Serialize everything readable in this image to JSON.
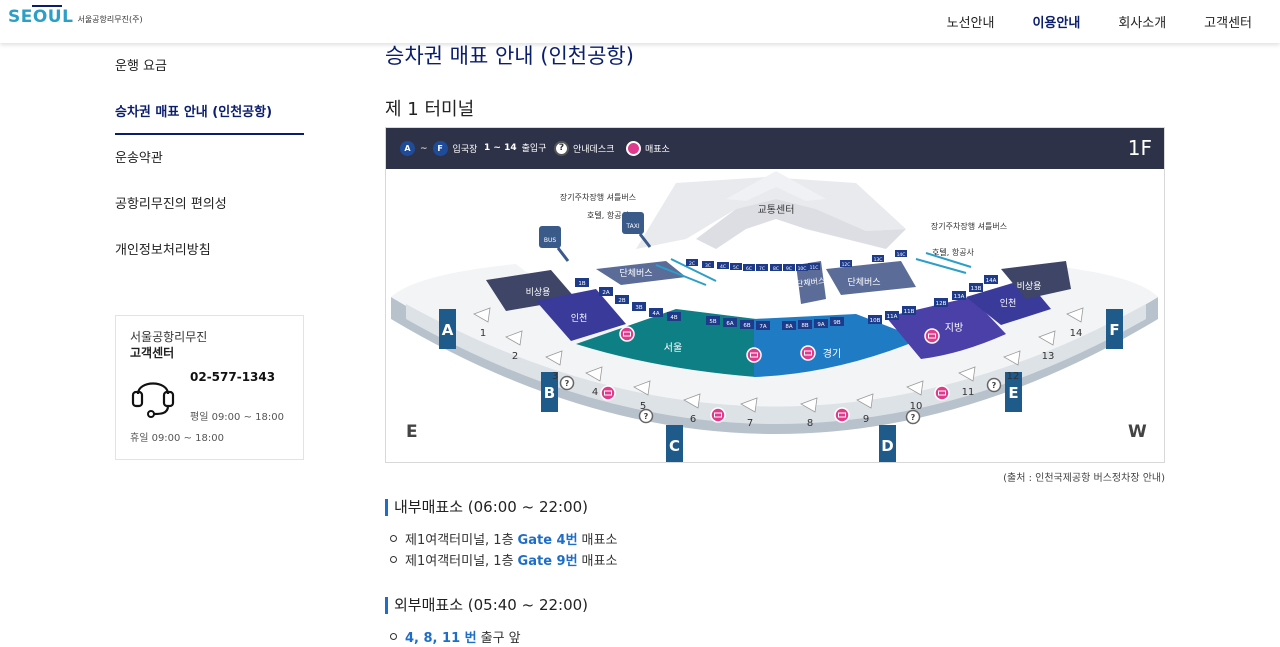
{
  "header": {
    "logo_word": "SEOUL",
    "logo_sub": "서울공항리무진(주)",
    "nav": [
      "노선안내",
      "이용안내",
      "회사소개",
      "고객센터"
    ],
    "active_nav": "이용안내"
  },
  "sidebar": {
    "items": [
      {
        "label": "운행 요금",
        "active": false
      },
      {
        "label": "승차권 매표 안내 (인천공항)",
        "active": true
      },
      {
        "label": "운송약관",
        "active": false
      },
      {
        "label": "공항리무진의 편의성",
        "active": false
      },
      {
        "label": "개인정보처리방침",
        "active": false
      }
    ]
  },
  "contact": {
    "company": "서울공항리무진",
    "title": "고객센터",
    "phone": "02-577-1343",
    "weekday": "평일 09:00 ~ 18:00",
    "holiday": "휴일 09:00 ~ 18:00",
    "icon": "headset-icon"
  },
  "main": {
    "title": "승차권 매표 안내 (인천공항)",
    "subtitle": "제 1 터미널",
    "source": "(출처 : 인천국제공항 버스정차장 안내)"
  },
  "map": {
    "legend": {
      "gate_a": "A",
      "gate_tilde": "~",
      "gate_f": "F",
      "gate_label": "입국장",
      "exits": "1 ~ 14",
      "exits_label": "출입구",
      "info_symbol": "?",
      "info_label": "안내데스크",
      "ticket_label": "매표소"
    },
    "floor": "1F",
    "labels": {
      "traffic_center": "교통센터",
      "long_term_left": "장기주차장행 셔틀버스",
      "hotel_left": "호텔, 항공사",
      "long_term_right": "장기주차장행 셔틀버스",
      "hotel_right": "호텔, 항공사",
      "group_bus_left": "단체버스",
      "group_bus_mid": "단체버스",
      "group_bus_right": "단체버스",
      "emergency_left": "비상용",
      "emergency_right": "비상용",
      "incheon_left": "인천",
      "incheon_right": "인천",
      "seoul": "서울",
      "gyeonggi": "경기",
      "local": "지방",
      "bus": "BUS",
      "taxi": "TAXI",
      "east": "E",
      "west": "W"
    },
    "gates": [
      "A",
      "B",
      "C",
      "D",
      "E",
      "F"
    ],
    "exits": [
      "1",
      "2",
      "3",
      "4",
      "5",
      "6",
      "7",
      "8",
      "9",
      "10",
      "11",
      "12",
      "13",
      "14"
    ],
    "stops_left": [
      "1B",
      "2A",
      "2B",
      "3B",
      "4A",
      "4B",
      "5B",
      "6A",
      "6B",
      "7A",
      "8A",
      "8B",
      "9A",
      "9B",
      "10B",
      "11A",
      "11B",
      "12B",
      "13A",
      "13B",
      "14A"
    ],
    "stops_top": [
      "2C",
      "3C",
      "4C",
      "5C",
      "6C",
      "7C",
      "8C",
      "9C",
      "10C",
      "11C",
      "12C",
      "13C",
      "14C"
    ]
  },
  "sections": [
    {
      "heading": "내부매표소 (06:00 ~ 22:00)",
      "items": [
        {
          "prefix": "제1여객터미널, 1층 ",
          "highlight": "Gate 4번",
          "suffix": " 매표소"
        },
        {
          "prefix": "제1여객터미널, 1층 ",
          "highlight": "Gate 9번",
          "suffix": " 매표소"
        }
      ]
    },
    {
      "heading": "외부매표소 (05:40 ~ 22:00)",
      "items": [
        {
          "prefix": "",
          "highlight": "4, 8, 11 번",
          "suffix": " 출구 앞"
        }
      ]
    }
  ],
  "colors": {
    "brand_navy": "#0b1e6e",
    "logo_blue": "#2b9fc8",
    "link_blue": "#1e6ec8",
    "legend_bg": "#2e3248",
    "zone_seoul": "#0f7f86",
    "zone_gyeonggi": "#1f7bc4",
    "zone_local": "#4b3fa8",
    "zone_incheon": "#3a3a9a",
    "zone_emergency": "#3f4566",
    "gate_blue": "#1e5a8a",
    "ticket_pink": "#e03a8c"
  }
}
